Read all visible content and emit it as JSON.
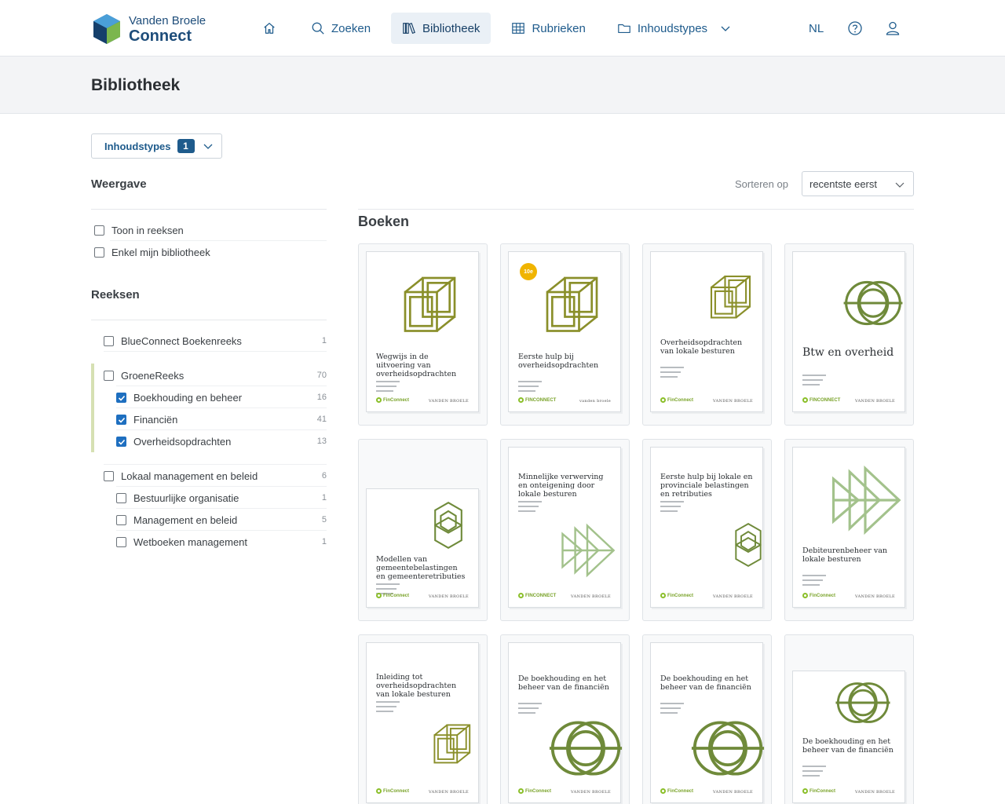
{
  "brand": {
    "line1": "Vanden Broele",
    "line2": "Connect"
  },
  "nav": {
    "home_icon": "home-icon",
    "items": [
      {
        "label": "Zoeken",
        "icon": "search-icon"
      },
      {
        "label": "Bibliotheek",
        "icon": "library-icon",
        "active": true
      },
      {
        "label": "Rubrieken",
        "icon": "table-icon"
      },
      {
        "label": "Inhoudstypes",
        "icon": "folder-icon",
        "has_dropdown": true
      }
    ],
    "language": "NL"
  },
  "page": {
    "title": "Bibliotheek"
  },
  "filters": {
    "content_types_label": "Inhoudstypes",
    "content_types_count": "1"
  },
  "view": {
    "title": "Weergave",
    "options": [
      {
        "label": "Toon in reeksen",
        "checked": false
      },
      {
        "label": "Enkel mijn bibliotheek",
        "checked": false
      }
    ]
  },
  "series": {
    "title": "Reeksen",
    "groups": [
      {
        "label": "BlueConnect Boekenreeks",
        "count": "1",
        "checked": false,
        "children": []
      },
      {
        "label": "GroeneReeks",
        "count": "70",
        "checked": false,
        "children": [
          {
            "label": "Boekhouding en beheer",
            "count": "16",
            "checked": true
          },
          {
            "label": "Financiën",
            "count": "41",
            "checked": true
          },
          {
            "label": "Overheidsopdrachten",
            "count": "13",
            "checked": true
          }
        ]
      },
      {
        "label": "Lokaal management en beleid",
        "count": "6",
        "checked": false,
        "children": [
          {
            "label": "Bestuurlijke organisatie",
            "count": "1",
            "checked": false
          },
          {
            "label": "Management en beleid",
            "count": "5",
            "checked": false
          },
          {
            "label": "Wetboeken management",
            "count": "1",
            "checked": false
          }
        ]
      }
    ]
  },
  "sort": {
    "label": "Sorteren op",
    "value": "recentste eerst"
  },
  "books": {
    "title": "Boeken",
    "items": [
      {
        "title": "Wegwijs in de uitvoering van overheidsopdrachten",
        "art": "cubes",
        "brand_left": "FinConnect",
        "brand_right": "VANDEN BROELE"
      },
      {
        "title": "Eerste hulp bij overheidsopdrachten",
        "art": "cubes",
        "brand_left": "FINCONNECT",
        "brand_right": "vanden broele",
        "badge": "10e"
      },
      {
        "title": "Overheidsopdrachten van lokale besturen",
        "art": "cubes",
        "brand_left": "FinConnect",
        "brand_right": "VANDEN BROELE"
      },
      {
        "title": "Btw en overheid",
        "art": "circles",
        "brand_left": "FINCONNECT",
        "brand_right": "VANDEN BROELE"
      },
      {
        "title": "Modellen van gemeentebelastingen en gemeenteretributies",
        "art": "hex",
        "brand_left": "FinConnect",
        "brand_right": "VANDEN BROELE"
      },
      {
        "title": "Minnelijke verwerving en onteigening door lokale besturen",
        "art": "arrows",
        "brand_left": "FINCONNECT",
        "brand_right": "VANDEN BROELE"
      },
      {
        "title": "Eerste hulp bij lokale en provinciale belastingen en retributies",
        "art": "hex",
        "brand_left": "FinConnect",
        "brand_right": "VANDEN BROELE"
      },
      {
        "title": "Debiteurenbeheer van lokale besturen",
        "art": "arrows",
        "brand_left": "FinConnect",
        "brand_right": "VANDEN BROELE"
      },
      {
        "title": "Inleiding tot overheidsopdrachten van lokale besturen",
        "art": "cubes",
        "brand_left": "FinConnect",
        "brand_right": "VANDEN BROELE"
      },
      {
        "title": "De boekhouding en het beheer van de financiën",
        "art": "circles",
        "brand_left": "FinConnect",
        "brand_right": "VANDEN BROELE"
      },
      {
        "title": "De boekhouding en het beheer van de financiën",
        "art": "circles",
        "brand_left": "FinConnect",
        "brand_right": "VANDEN BROELE"
      },
      {
        "title": "De boekhouding en het beheer van de financiën",
        "art": "circles",
        "brand_left": "FinConnect",
        "brand_right": "VANDEN BROELE"
      }
    ]
  },
  "colors": {
    "accent": "#1e5b8c",
    "olive": "#8a8f2a",
    "green": "#6f8a3a",
    "light_green": "#a3c28c"
  }
}
